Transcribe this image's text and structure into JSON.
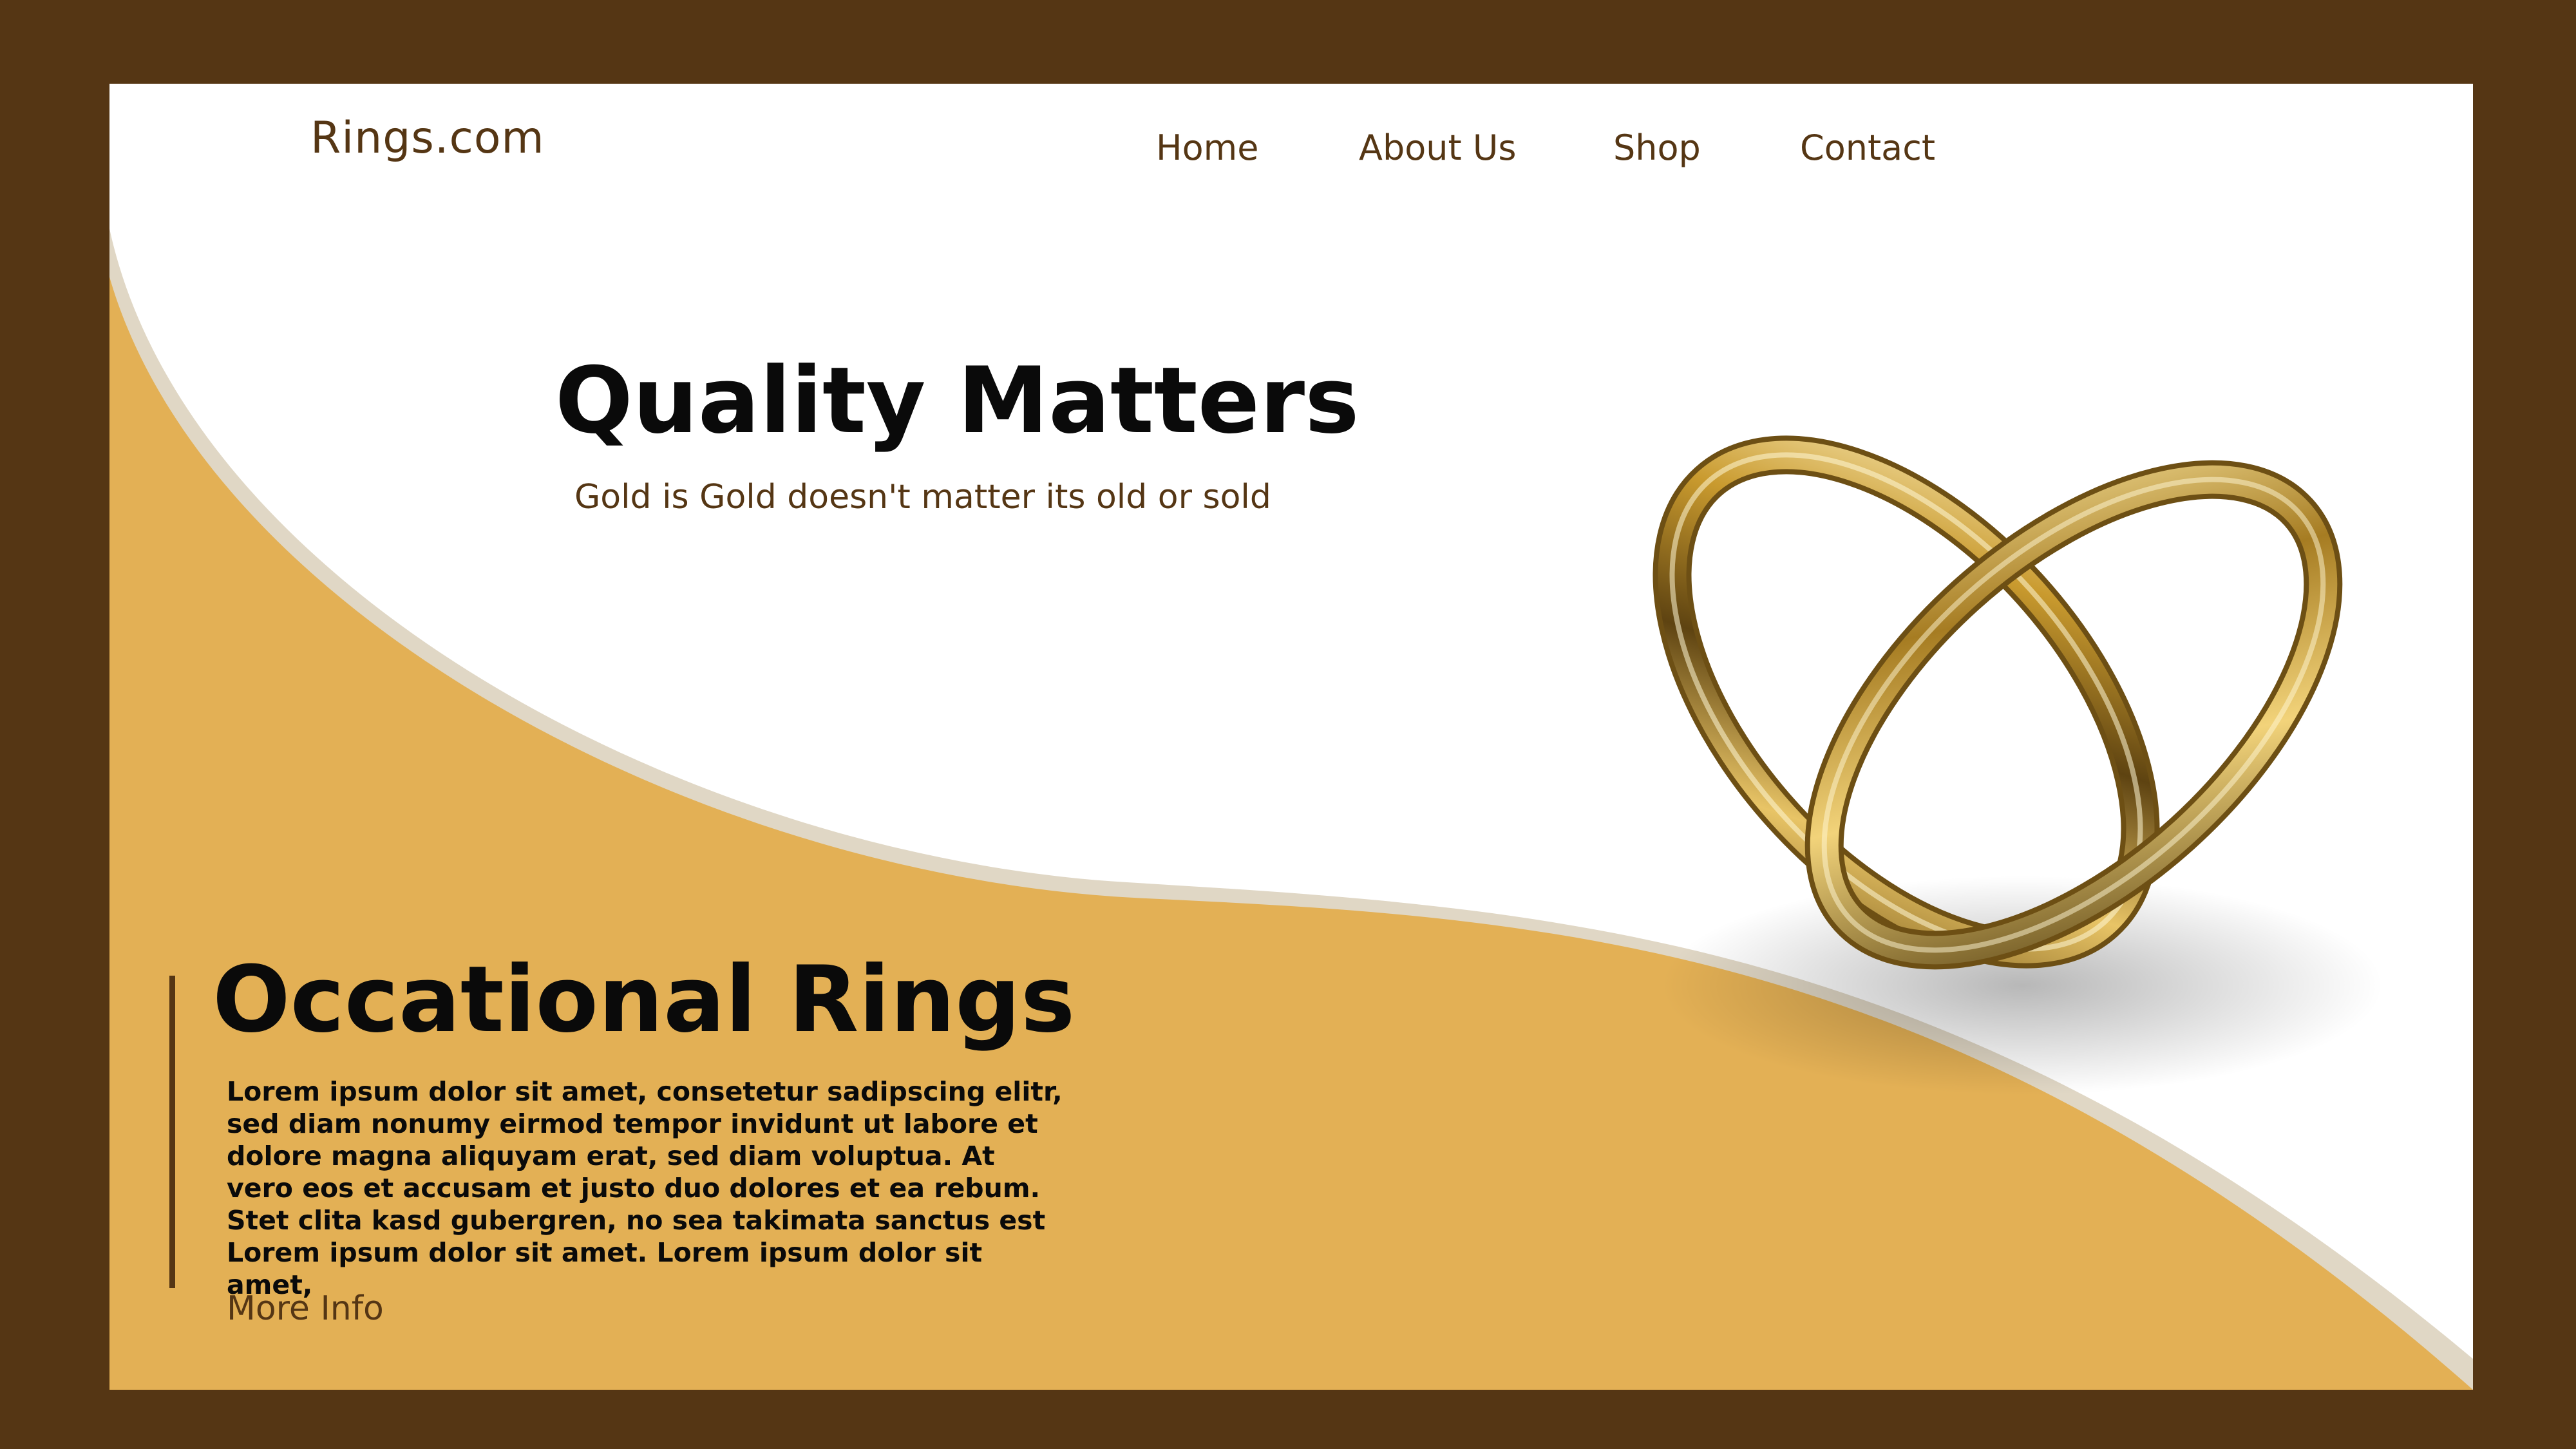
{
  "brand": {
    "logo_text": "Rings.com"
  },
  "nav": {
    "items": [
      "Home",
      "About Us",
      "Shop",
      "Contact"
    ]
  },
  "hero": {
    "title": "Quality Matters",
    "subtitle": "Gold is Gold doesn't matter its old or sold",
    "image_icon": "gold-rings-icon"
  },
  "section": {
    "title": "Occational Rings",
    "body": "Lorem ipsum dolor sit amet, consetetur sadipscing elitr, sed diam nonumy eirmod tempor invidunt ut labore et dolore magna aliquyam erat, sed diam voluptua. At vero eos et accusam et justo duo dolores et ea rebum. Stet clita kasd gubergren, no sea takimata sanctus est Lorem ipsum dolor sit amet. Lorem ipsum dolor sit amet,",
    "link_label": "More Info"
  },
  "colors": {
    "frame": "#553614",
    "accent_gold": "#e3b055",
    "wave_shadow": "#e0d7c5",
    "card": "#ffffff",
    "text_dark": "#0a0a0a"
  }
}
